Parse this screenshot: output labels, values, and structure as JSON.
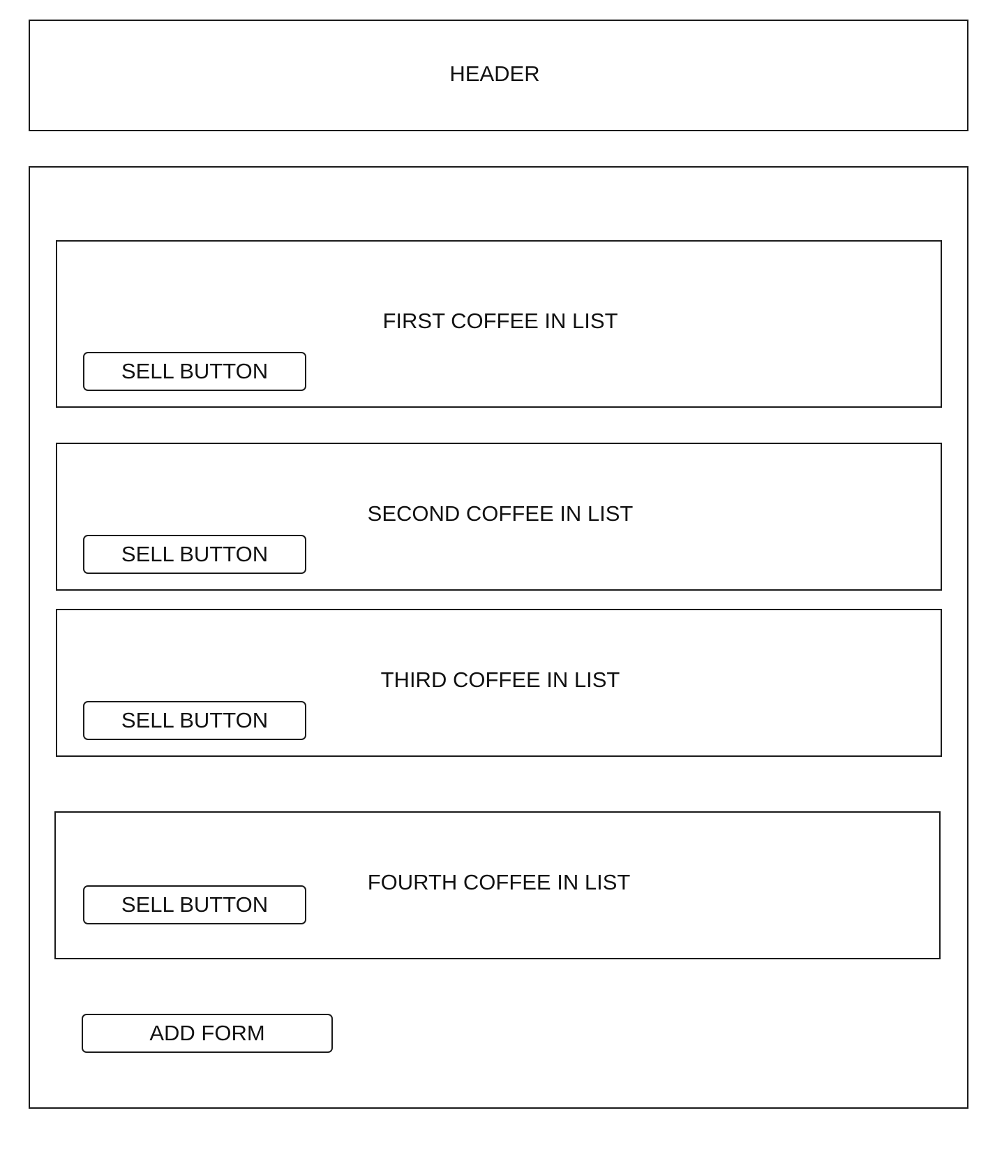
{
  "header": {
    "label": "HEADER"
  },
  "coffee_list": [
    {
      "title": "FIRST COFFEE IN LIST",
      "button": "SELL BUTTON"
    },
    {
      "title": "SECOND COFFEE IN LIST",
      "button": "SELL BUTTON"
    },
    {
      "title": "THIRD COFFEE IN LIST",
      "button": "SELL BUTTON"
    },
    {
      "title": "FOURTH COFFEE IN LIST",
      "button": "SELL BUTTON"
    }
  ],
  "add_form": {
    "label": "ADD FORM"
  }
}
